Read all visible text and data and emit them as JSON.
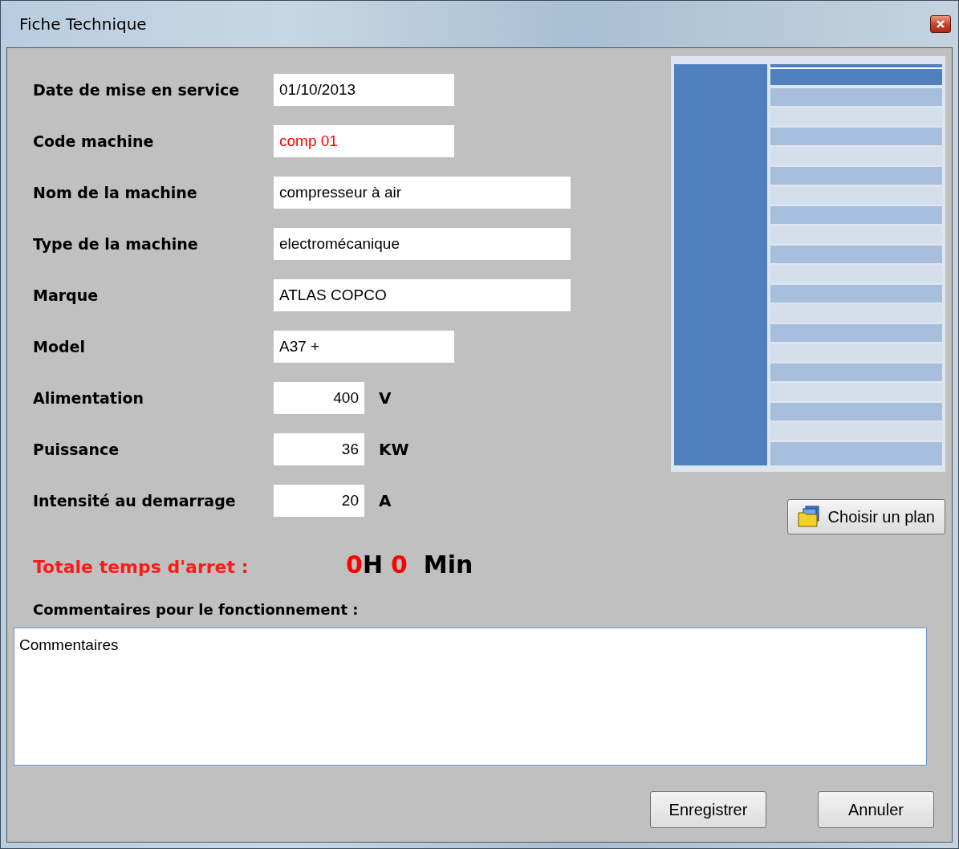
{
  "window": {
    "title": "Fiche Technique"
  },
  "fields": [
    {
      "label": "Date de mise en service",
      "value": "01/10/2013",
      "kind": "short",
      "color": "#000000"
    },
    {
      "label": "Code machine",
      "value": "comp 01",
      "kind": "short",
      "color": "#ff0000"
    },
    {
      "label": "Nom de la machine",
      "value": "compresseur à air",
      "kind": "long",
      "color": "#000000"
    },
    {
      "label": "Type de la machine",
      "value": "electromécanique",
      "kind": "long",
      "color": "#000000"
    },
    {
      "label": "Marque",
      "value": "ATLAS COPCO",
      "kind": "long",
      "color": "#000000"
    },
    {
      "label": "Model",
      "value": "A37 +",
      "kind": "short",
      "color": "#000000"
    },
    {
      "label": "Alimentation",
      "value": "400",
      "unit": "V",
      "kind": "number",
      "color": "#000000"
    },
    {
      "label": "Puissance",
      "value": "36",
      "unit": "KW",
      "kind": "number",
      "color": "#000000"
    },
    {
      "label": "Intensité au demarrage",
      "value": "20",
      "unit": "A",
      "kind": "number",
      "color": "#000000"
    }
  ],
  "plan": {
    "kind": "picture",
    "button": "Choisir un plan"
  },
  "downtime": {
    "label": "Totale temps d'arret :",
    "hours": "0",
    "hours_unit": "H",
    "minutes": "0",
    "minutes_unit": "Min"
  },
  "comments": {
    "label": "Commentaires pour le fonctionnement :",
    "value": "Commentaires"
  },
  "buttons": [
    "Enregistrer",
    "Annuler"
  ]
}
